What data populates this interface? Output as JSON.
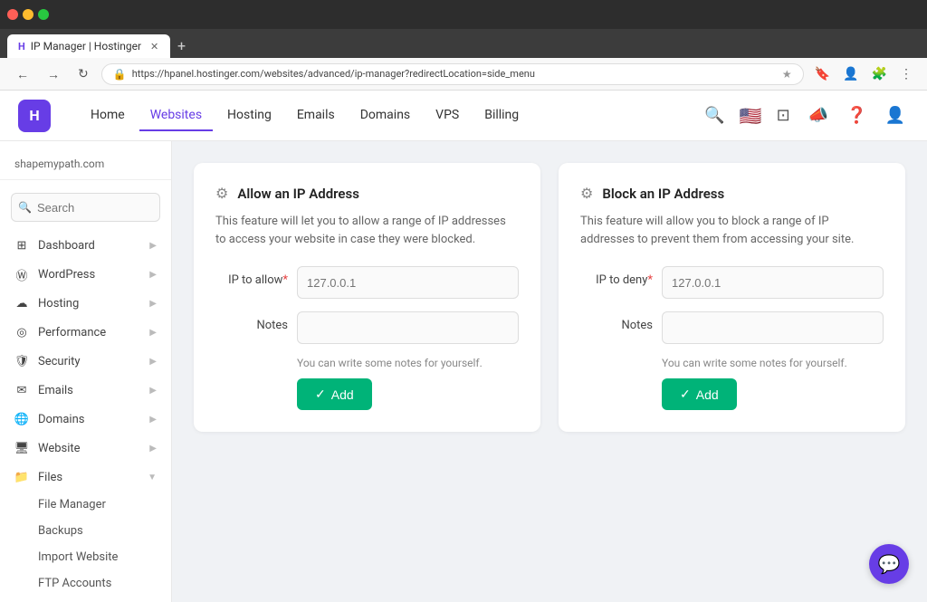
{
  "browser": {
    "tab_title": "IP Manager | Hostinger",
    "tab_favicon": "H",
    "url": "https://hpanel.hostinger.com/websites/advanced/ip-manager?redirectLocation=side_menu",
    "new_tab_label": "+"
  },
  "topnav": {
    "logo_text": "H",
    "links": [
      {
        "label": "Home",
        "active": false
      },
      {
        "label": "Websites",
        "active": true
      },
      {
        "label": "Hosting",
        "active": false
      },
      {
        "label": "Emails",
        "active": false
      },
      {
        "label": "Domains",
        "active": false
      },
      {
        "label": "VPS",
        "active": false
      },
      {
        "label": "Billing",
        "active": false
      }
    ]
  },
  "sidebar": {
    "domain": "shapemypath.com",
    "search_placeholder": "Search",
    "items": [
      {
        "label": "Dashboard",
        "icon": "grid",
        "expandable": true
      },
      {
        "label": "WordPress",
        "icon": "wp",
        "expandable": true
      },
      {
        "label": "Hosting",
        "icon": "hosting",
        "expandable": true
      },
      {
        "label": "Performance",
        "icon": "perf",
        "expandable": true
      },
      {
        "label": "Security",
        "icon": "security",
        "expandable": true
      },
      {
        "label": "Emails",
        "icon": "email",
        "expandable": true
      },
      {
        "label": "Domains",
        "icon": "domain",
        "expandable": true
      },
      {
        "label": "Website",
        "icon": "website",
        "expandable": true
      },
      {
        "label": "Files",
        "icon": "files",
        "expandable": false,
        "expanded": true
      }
    ],
    "files_sub_items": [
      {
        "label": "File Manager"
      },
      {
        "label": "Backups"
      },
      {
        "label": "Import Website"
      },
      {
        "label": "FTP Accounts"
      }
    ]
  },
  "allow_card": {
    "title": "Allow an IP Address",
    "description": "This feature will let you to allow a range of IP addresses to access your website in case they were blocked.",
    "ip_label": "IP to allow",
    "ip_placeholder": "127.0.0.1",
    "notes_label": "Notes",
    "notes_placeholder": "",
    "hint": "You can write some notes for yourself.",
    "btn_label": "Add"
  },
  "block_card": {
    "title": "Block an IP Address",
    "description": "This feature will allow you to block a range of IP addresses to prevent them from accessing your site.",
    "ip_label": "IP to deny",
    "ip_placeholder": "127.0.0.1",
    "notes_label": "Notes",
    "notes_placeholder": "",
    "hint": "You can write some notes for yourself.",
    "btn_label": "Add"
  },
  "chat": {
    "icon": "💬"
  }
}
